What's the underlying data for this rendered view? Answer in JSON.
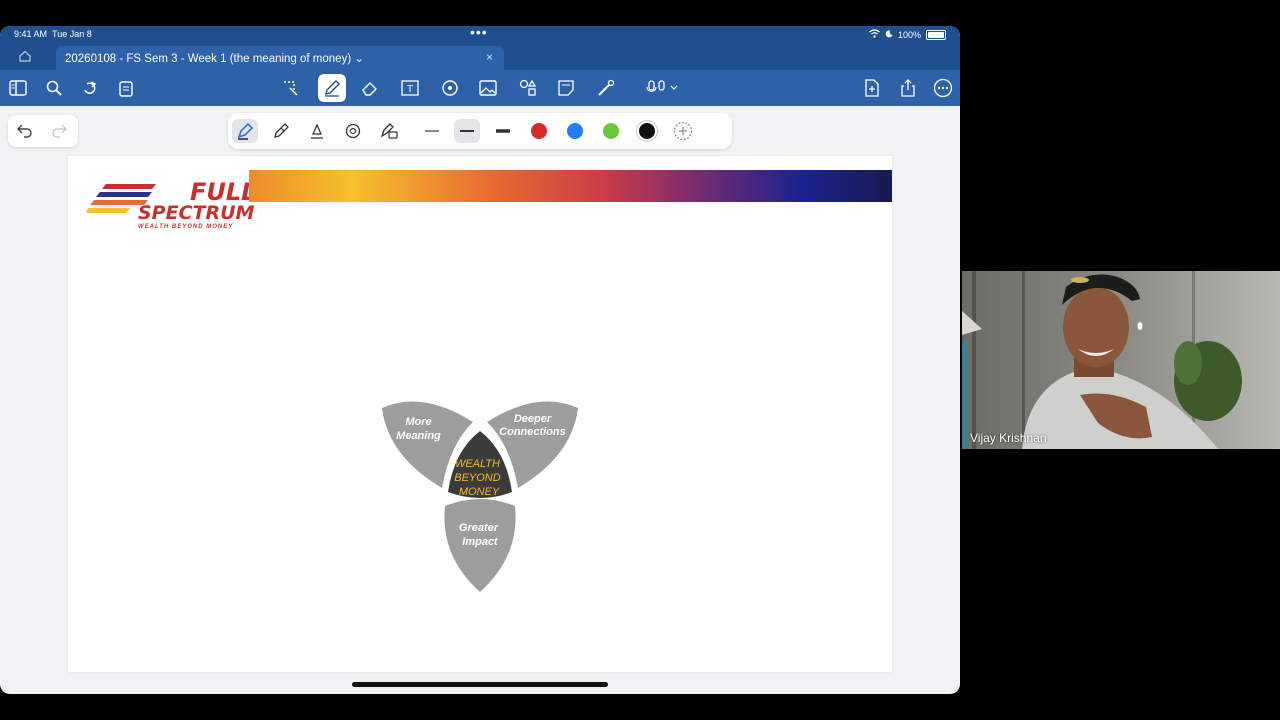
{
  "status_bar": {
    "time": "9:41 AM",
    "date": "Tue Jan 8",
    "battery": "100%"
  },
  "tab": {
    "title": "20260108 - FS Sem 3 - Week 1 (the meaning of money) ⌄",
    "close": "×"
  },
  "ribbon": {
    "icons": [
      "sidebar-icon",
      "search-icon",
      "redo-icon",
      "clipboard-icon",
      "lasso-icon",
      "pen-icon",
      "eraser-icon",
      "textbox-icon",
      "shape-icon",
      "image-icon",
      "shapes-icon",
      "sticky-note-icon",
      "laser-pointer-icon",
      "audio-icon"
    ],
    "right_icons": [
      "add-page-icon",
      "share-icon",
      "more-icon"
    ]
  },
  "pen_tools": {
    "colors": [
      "#d62b22",
      "#1f7ff2",
      "#6ac73a",
      "#111111"
    ]
  },
  "logo": {
    "line1": "FULL",
    "line2": "SPECTRUM",
    "tagline": "WEALTH BEYOND MONEY"
  },
  "diagram": {
    "petals": {
      "top_left": "More\nMeaning",
      "top_right": "Deeper\nConnections",
      "bottom": "Greater\nImpact"
    },
    "center": [
      "WEALTH",
      "BEYOND",
      "MONEY"
    ],
    "center_color": "#f2b928"
  },
  "video": {
    "participant_name": "Vijay Krishnan"
  }
}
